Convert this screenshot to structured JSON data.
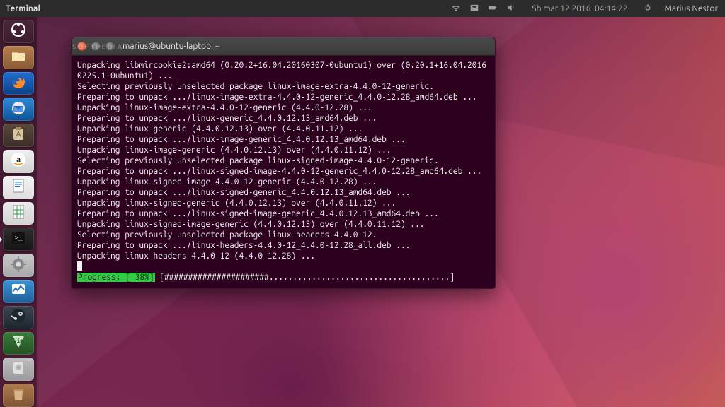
{
  "panel": {
    "app_label": "Terminal",
    "date": "Sb mar 12 2016",
    "time": "04:14:22",
    "user": "Marius Nestor"
  },
  "watermark": "SOFTPEDIA",
  "launcher": {
    "items": [
      {
        "name": "dash",
        "cls": "t-dash"
      },
      {
        "name": "files",
        "cls": "t-files"
      },
      {
        "name": "firefox",
        "cls": "t-firefox"
      },
      {
        "name": "thunderbird",
        "cls": "t-tbird"
      },
      {
        "name": "software-center",
        "cls": "t-sw"
      },
      {
        "name": "amazon",
        "cls": "t-amazon"
      },
      {
        "name": "libreoffice-writer",
        "cls": "t-writer"
      },
      {
        "name": "libreoffice-calc",
        "cls": "t-calc"
      },
      {
        "name": "terminal",
        "cls": "t-term",
        "active": true
      },
      {
        "name": "system-settings",
        "cls": "t-settings"
      },
      {
        "name": "system-monitor",
        "cls": "t-sysmon"
      },
      {
        "name": "steam",
        "cls": "t-steam"
      },
      {
        "name": "gvim",
        "cls": "t-gvim"
      },
      {
        "name": "disks",
        "cls": "t-disks"
      },
      {
        "name": "trash",
        "cls": "t-trash"
      }
    ]
  },
  "window": {
    "title": "marius@ubuntu-laptop: ~",
    "lines": [
      "Unpacking libmircookie2:amd64 (0.20.2+16.04.20160307-0ubuntu1) over (0.20.1+16.04.20160225.1-0ubuntu1) ...",
      "Selecting previously unselected package linux-image-extra-4.4.0-12-generic.",
      "Preparing to unpack .../linux-image-extra-4.4.0-12-generic_4.4.0-12.28_amd64.deb ...",
      "Unpacking linux-image-extra-4.4.0-12-generic (4.4.0-12.28) ...",
      "Preparing to unpack .../linux-generic_4.4.0.12.13_amd64.deb ...",
      "Unpacking linux-generic (4.4.0.12.13) over (4.4.0.11.12) ...",
      "Preparing to unpack .../linux-image-generic_4.4.0.12.13_amd64.deb ...",
      "Unpacking linux-image-generic (4.4.0.12.13) over (4.4.0.11.12) ...",
      "Selecting previously unselected package linux-signed-image-4.4.0-12-generic.",
      "Preparing to unpack .../linux-signed-image-4.4.0-12-generic_4.4.0-12.28_amd64.deb ...",
      "Unpacking linux-signed-image-4.4.0-12-generic (4.4.0-12.28) ...",
      "Preparing to unpack .../linux-signed-generic_4.4.0.12.13_amd64.deb ...",
      "Unpacking linux-signed-generic (4.4.0.12.13) over (4.4.0.11.12) ...",
      "Preparing to unpack .../linux-signed-image-generic_4.4.0.12.13_amd64.deb ...",
      "Unpacking linux-signed-image-generic (4.4.0.12.13) over (4.4.0.11.12) ...",
      "Selecting previously unselected package linux-headers-4.4.0-12.",
      "Preparing to unpack .../linux-headers-4.4.0-12_4.4.0-12.28_all.deb ...",
      "Unpacking linux-headers-4.4.0-12 (4.4.0-12.28) ..."
    ],
    "progress": {
      "label": "Progress: [ 38%]",
      "filled": 22,
      "total": 60
    }
  }
}
